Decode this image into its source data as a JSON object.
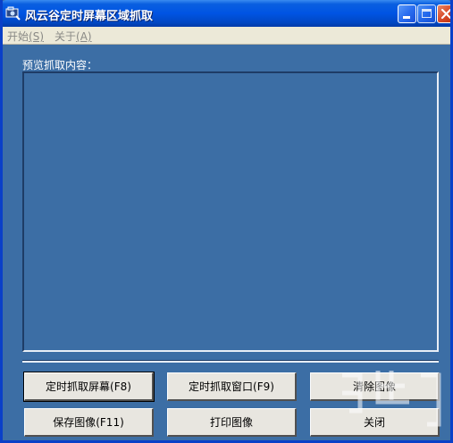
{
  "window": {
    "title": "风云谷定时屏幕区域抓取",
    "app_icon": "camera-app-icon"
  },
  "titlebar_buttons": {
    "minimize_icon": "minimize-icon",
    "maximize_icon": "maximize-icon",
    "close_icon": "close-icon"
  },
  "menu": {
    "start": {
      "label": "开始",
      "accel": "(S)"
    },
    "about": {
      "label": "关于",
      "accel": "(A)"
    }
  },
  "preview": {
    "label": "预览抓取内容："
  },
  "buttons": {
    "capture_screen": "定时抓取屏幕(F8)",
    "capture_window": "定时抓取窗口(F9)",
    "clear_image": "清除图像",
    "save_image": "保存图像(F11)",
    "print_image": "打印图像",
    "close": "关闭"
  },
  "colors": {
    "client_background": "#3c6ea5",
    "titlebar_blue": "#0054e3",
    "close_red": "#d84a28",
    "button_face": "#e8e6e0"
  },
  "watermark": {
    "kind": "site-watermark-logo"
  }
}
